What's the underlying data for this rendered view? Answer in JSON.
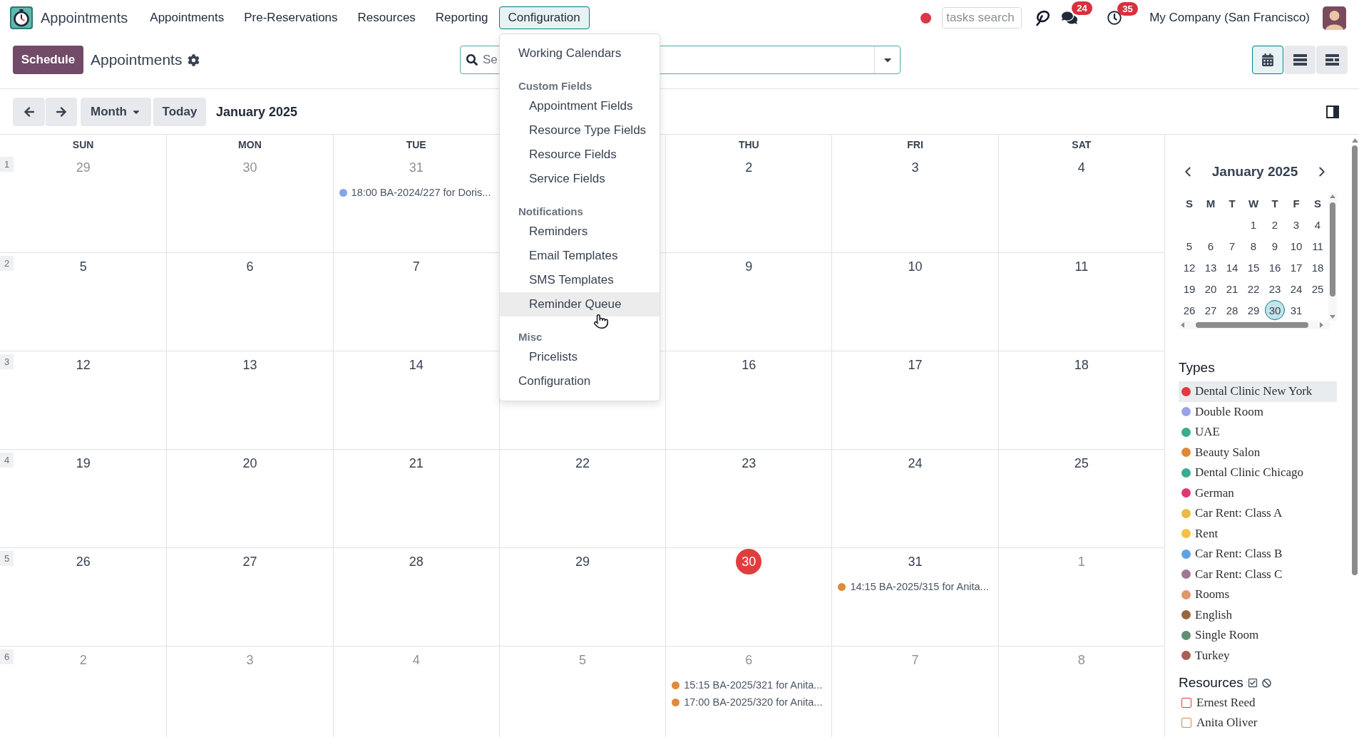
{
  "navbar": {
    "app_name": "Appointments",
    "menu": [
      {
        "label": "Appointments",
        "selected": false
      },
      {
        "label": "Pre-Reservations",
        "selected": false
      },
      {
        "label": "Resources",
        "selected": false
      },
      {
        "label": "Reporting",
        "selected": false
      },
      {
        "label": "Configuration",
        "selected": true
      }
    ],
    "tasks_search": {
      "placeholder": "tasks search"
    },
    "messages_count": "24",
    "activities_count": "35",
    "company": "My Company (San Francisco)"
  },
  "control_panel": {
    "primary_button": "Schedule",
    "title": "Appointments",
    "search": {
      "placeholder": "Se"
    },
    "views": [
      {
        "kind": "calendar",
        "selected": true
      },
      {
        "kind": "list",
        "selected": false
      },
      {
        "kind": "gantt",
        "selected": false
      }
    ],
    "scale": "Month",
    "today_button": "Today",
    "period": "January 2025"
  },
  "config_menu": {
    "items": [
      {
        "kind": "item",
        "label": "Working Calendars",
        "highlighted": false
      },
      {
        "kind": "header",
        "label": "Custom Fields"
      },
      {
        "kind": "subitem",
        "label": "Appointment Fields",
        "highlighted": false
      },
      {
        "kind": "subitem",
        "label": "Resource Type Fields",
        "highlighted": false
      },
      {
        "kind": "subitem",
        "label": "Resource Fields",
        "highlighted": false
      },
      {
        "kind": "subitem",
        "label": "Service Fields",
        "highlighted": false
      },
      {
        "kind": "header",
        "label": "Notifications"
      },
      {
        "kind": "subitem",
        "label": "Reminders",
        "highlighted": false
      },
      {
        "kind": "subitem",
        "label": "Email Templates",
        "highlighted": false
      },
      {
        "kind": "subitem",
        "label": "SMS Templates",
        "highlighted": false
      },
      {
        "kind": "subitem",
        "label": "Reminder Queue",
        "highlighted": true
      },
      {
        "kind": "header",
        "label": "Misc"
      },
      {
        "kind": "subitem",
        "label": "Pricelists",
        "highlighted": false
      },
      {
        "kind": "item",
        "label": "Configuration",
        "highlighted": false
      }
    ]
  },
  "calendar": {
    "weekdays": {
      "sun": "SUN",
      "mon": "MON",
      "tue": "TUE",
      "thu": "THU",
      "fri": "FRI",
      "sat": "SAT"
    },
    "weeks": [
      {
        "number": "1",
        "days": {
          "sun": {
            "date": "29",
            "other_month": true,
            "today": false
          },
          "mon": {
            "date": "30",
            "other_month": true,
            "today": false
          },
          "tue": {
            "date": "31",
            "other_month": true,
            "today": false,
            "events": [
              {
                "label": "18:00 BA-2024/227 for Doris...",
                "color": "#86a5e8"
              }
            ]
          },
          "thu": {
            "date": "2",
            "other_month": false,
            "today": false
          },
          "fri": {
            "date": "3",
            "other_month": false,
            "today": false
          },
          "sat": {
            "date": "4",
            "other_month": false,
            "today": false
          }
        }
      },
      {
        "number": "2",
        "days": {
          "sun": {
            "date": "5",
            "other_month": false,
            "today": false
          },
          "mon": {
            "date": "6",
            "other_month": false,
            "today": false
          },
          "tue": {
            "date": "7",
            "other_month": false,
            "today": false
          },
          "thu": {
            "date": "9",
            "other_month": false,
            "today": false
          },
          "fri": {
            "date": "10",
            "other_month": false,
            "today": false
          },
          "sat": {
            "date": "11",
            "other_month": false,
            "today": false
          }
        }
      },
      {
        "number": "3",
        "days": {
          "sun": {
            "date": "12",
            "other_month": false,
            "today": false
          },
          "mon": {
            "date": "13",
            "other_month": false,
            "today": false
          },
          "tue": {
            "date": "14",
            "other_month": false,
            "today": false
          },
          "thu": {
            "date": "16",
            "other_month": false,
            "today": false
          },
          "fri": {
            "date": "17",
            "other_month": false,
            "today": false
          },
          "sat": {
            "date": "18",
            "other_month": false,
            "today": false
          }
        }
      },
      {
        "number": "4",
        "days": {
          "sun": {
            "date": "19",
            "other_month": false,
            "today": false
          },
          "mon": {
            "date": "20",
            "other_month": false,
            "today": false
          },
          "tue": {
            "date": "21",
            "other_month": false,
            "today": false
          },
          "wed": {
            "date": "22",
            "other_month": false,
            "today": false
          },
          "thu": {
            "date": "23",
            "other_month": false,
            "today": false
          },
          "fri": {
            "date": "24",
            "other_month": false,
            "today": false
          },
          "sat": {
            "date": "25",
            "other_month": false,
            "today": false
          }
        }
      },
      {
        "number": "5",
        "days": {
          "sun": {
            "date": "26",
            "other_month": false,
            "today": false
          },
          "mon": {
            "date": "27",
            "other_month": false,
            "today": false
          },
          "tue": {
            "date": "28",
            "other_month": false,
            "today": false
          },
          "wed": {
            "date": "29",
            "other_month": false,
            "today": false
          },
          "thu": {
            "date": "30",
            "other_month": false,
            "today": true
          },
          "fri": {
            "date": "31",
            "other_month": false,
            "today": false,
            "events": [
              {
                "label": "14:15 BA-2025/315 for Anita...",
                "color": "#e08a3a"
              }
            ]
          },
          "sat": {
            "date": "1",
            "other_month": true,
            "today": false
          }
        }
      },
      {
        "number": "6",
        "days": {
          "sun": {
            "date": "2",
            "other_month": true,
            "today": false
          },
          "mon": {
            "date": "3",
            "other_month": true,
            "today": false
          },
          "tue": {
            "date": "4",
            "other_month": true,
            "today": false
          },
          "wed": {
            "date": "5",
            "other_month": true,
            "today": false
          },
          "thu": {
            "date": "6",
            "other_month": true,
            "today": false,
            "events": [
              {
                "label": "15:15 BA-2025/321 for Anita...",
                "color": "#e08a3a"
              },
              {
                "label": "17:00 BA-2025/320 for Anita...",
                "color": "#e08a3a"
              }
            ]
          },
          "fri": {
            "date": "7",
            "other_month": true,
            "today": false
          },
          "sat": {
            "date": "8",
            "other_month": true,
            "today": false
          }
        }
      }
    ]
  },
  "sidebar": {
    "mini_calendar": {
      "title": "January 2025",
      "weekdays": [
        "S",
        "M",
        "T",
        "W",
        "T",
        "F",
        "S"
      ],
      "weeks": [
        {
          "wed": {
            "day": "1",
            "selected": false
          },
          "thu": {
            "day": "2",
            "selected": false
          },
          "fri": {
            "day": "3",
            "selected": false
          },
          "sat": {
            "day": "4",
            "selected": false
          }
        },
        {
          "sun": {
            "day": "5",
            "selected": false
          },
          "mon": {
            "day": "6",
            "selected": false
          },
          "tue": {
            "day": "7",
            "selected": false
          },
          "wed": {
            "day": "8",
            "selected": false
          },
          "thu": {
            "day": "9",
            "selected": false
          },
          "fri": {
            "day": "10",
            "selected": false
          },
          "sat": {
            "day": "11",
            "selected": false
          }
        },
        {
          "sun": {
            "day": "12",
            "selected": false
          },
          "mon": {
            "day": "13",
            "selected": false
          },
          "tue": {
            "day": "14",
            "selected": false
          },
          "wed": {
            "day": "15",
            "selected": false
          },
          "thu": {
            "day": "16",
            "selected": false
          },
          "fri": {
            "day": "17",
            "selected": false
          },
          "sat": {
            "day": "18",
            "selected": false
          }
        },
        {
          "sun": {
            "day": "19",
            "selected": false
          },
          "mon": {
            "day": "20",
            "selected": false
          },
          "tue": {
            "day": "21",
            "selected": false
          },
          "wed": {
            "day": "22",
            "selected": false
          },
          "thu": {
            "day": "23",
            "selected": false
          },
          "fri": {
            "day": "24",
            "selected": false
          },
          "sat": {
            "day": "25",
            "selected": false
          }
        },
        {
          "sun": {
            "day": "26",
            "selected": false
          },
          "mon": {
            "day": "27",
            "selected": false
          },
          "tue": {
            "day": "28",
            "selected": false
          },
          "wed": {
            "day": "29",
            "selected": false
          },
          "thu": {
            "day": "30",
            "selected": true
          },
          "fri": {
            "day": "31",
            "selected": false
          }
        }
      ]
    },
    "types": {
      "title": "Types",
      "items": [
        {
          "name": "Dental Clinic New York",
          "color": "#e0393e",
          "highlighted": true
        },
        {
          "name": "Double Room",
          "color": "#98a2e6",
          "highlighted": false
        },
        {
          "name": "UAE",
          "color": "#3aab8f",
          "highlighted": false
        },
        {
          "name": "Beauty Salon",
          "color": "#e0883a",
          "highlighted": false
        },
        {
          "name": "Dental Clinic Chicago",
          "color": "#3aab8e",
          "highlighted": false
        },
        {
          "name": "German",
          "color": "#e0386e",
          "highlighted": false
        },
        {
          "name": "Car Rent: Class A",
          "color": "#ebb945",
          "highlighted": false
        },
        {
          "name": "Rent",
          "color": "#f4c242",
          "highlighted": false
        },
        {
          "name": "Car Rent: Class B",
          "color": "#5ea2e6",
          "highlighted": false
        },
        {
          "name": "Car Rent: Class C",
          "color": "#a07890",
          "highlighted": false
        },
        {
          "name": "Rooms",
          "color": "#e0986a",
          "highlighted": false
        },
        {
          "name": "English",
          "color": "#9a6640",
          "highlighted": false
        },
        {
          "name": "Single Room",
          "color": "#5f9074",
          "highlighted": false
        },
        {
          "name": "Turkey",
          "color": "#a85f55",
          "highlighted": false
        }
      ]
    },
    "resources": {
      "title": "Resources",
      "items": [
        {
          "name": "Ernest Reed",
          "checked": false,
          "color": "#e0393e"
        },
        {
          "name": "Anita Oliver",
          "checked": false,
          "color": "#e0883a"
        }
      ]
    }
  }
}
